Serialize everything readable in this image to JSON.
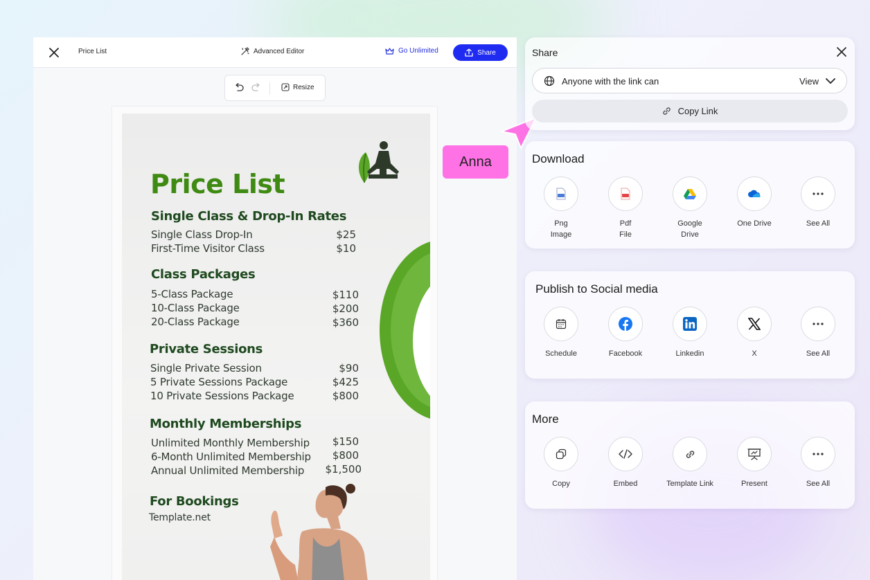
{
  "editor": {
    "doc_title": "Price List",
    "advanced_editor": "Advanced Editor",
    "go_unlimited": "Go Unlimited",
    "share": "Share",
    "resize": "Resize"
  },
  "poster": {
    "title": "Price List",
    "sections": [
      {
        "heading": "Single Class & Drop-In Rates",
        "rows": [
          [
            "Single Class Drop-In",
            "$25"
          ],
          [
            "First-Time Visitor Class",
            "$10"
          ]
        ]
      },
      {
        "heading": "Class Packages",
        "rows": [
          [
            "5-Class Package",
            "$110"
          ],
          [
            "10-Class Package",
            "$200"
          ],
          [
            "20-Class Package",
            "$360"
          ]
        ]
      },
      {
        "heading": "Private Sessions",
        "rows": [
          [
            "Single Private Session",
            "$90"
          ],
          [
            "5 Private Sessions Package",
            "$425"
          ],
          [
            "10 Private Sessions Package",
            "$800"
          ]
        ]
      },
      {
        "heading": "Monthly Memberships",
        "rows": [
          [
            "Unlimited Monthly Membership",
            "$150"
          ],
          [
            "6-Month Unlimited Membership",
            "$800"
          ],
          [
            "Annual Unlimited Membership",
            "$1,500"
          ]
        ]
      }
    ],
    "bookings_heading": "For Bookings",
    "bookings_site": "Template.net"
  },
  "share_panel": {
    "title": "Share",
    "access_label": "Anyone with the link can",
    "access_value": "View",
    "copy_link": "Copy Link"
  },
  "download": {
    "title": "Download",
    "options": [
      {
        "label1": "Png",
        "label2": "Image",
        "icon": "png-file-icon"
      },
      {
        "label1": "Pdf",
        "label2": "File",
        "icon": "pdf-file-icon"
      },
      {
        "label1": "Google",
        "label2": "Drive",
        "icon": "google-drive-icon"
      },
      {
        "label1": "One Drive",
        "label2": "",
        "icon": "onedrive-icon"
      },
      {
        "label1": "See All",
        "label2": "",
        "icon": "more-dots-icon"
      }
    ]
  },
  "social": {
    "title": "Publish to Social media",
    "options": [
      {
        "label": "Schedule",
        "icon": "calendar-icon"
      },
      {
        "label": "Facebook",
        "icon": "facebook-icon"
      },
      {
        "label": "Linkedin",
        "icon": "linkedin-icon"
      },
      {
        "label": "X",
        "icon": "x-icon"
      },
      {
        "label": "See All",
        "icon": "more-dots-icon"
      }
    ]
  },
  "more": {
    "title": "More",
    "options": [
      {
        "label": "Copy",
        "icon": "copy-icon"
      },
      {
        "label": "Embed",
        "icon": "code-icon"
      },
      {
        "label": "Template Link",
        "icon": "link-icon"
      },
      {
        "label": "Present",
        "icon": "present-icon"
      },
      {
        "label": "See All",
        "icon": "more-dots-icon"
      }
    ]
  },
  "collaborator": {
    "name": "Anna",
    "color": "#ff72e6"
  },
  "colors": {
    "brand": "#1f2bf0",
    "poster_green": "#3e8a12"
  }
}
